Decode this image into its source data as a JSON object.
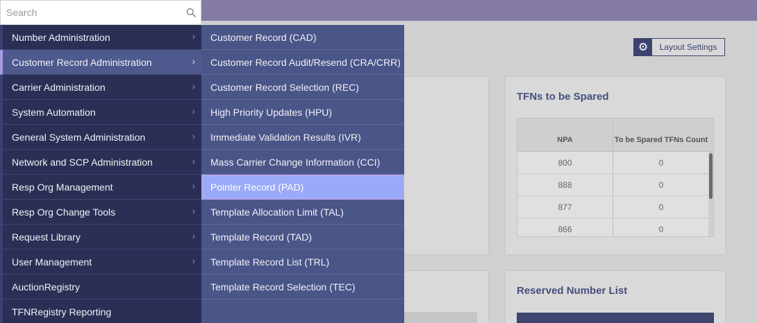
{
  "search": {
    "placeholder": "Search"
  },
  "layout_settings": {
    "label": "Layout Settings"
  },
  "menu": {
    "items": [
      {
        "label": "Number Administration",
        "has_submenu": true
      },
      {
        "label": "Customer Record Administration",
        "has_submenu": true,
        "active": true
      },
      {
        "label": "Carrier Administration",
        "has_submenu": true
      },
      {
        "label": "System Automation",
        "has_submenu": true
      },
      {
        "label": "General System Administration",
        "has_submenu": true
      },
      {
        "label": "Network and SCP Administration",
        "has_submenu": true
      },
      {
        "label": "Resp Org Management",
        "has_submenu": true
      },
      {
        "label": "Resp Org Change Tools",
        "has_submenu": true
      },
      {
        "label": "Request Library",
        "has_submenu": true
      },
      {
        "label": "User Management",
        "has_submenu": true
      },
      {
        "label": "AuctionRegistry",
        "has_submenu": false
      },
      {
        "label": "TFNRegistry Reporting",
        "has_submenu": false
      }
    ],
    "chevron": "›"
  },
  "submenu": {
    "items": [
      {
        "label": "Customer Record (CAD)"
      },
      {
        "label": "Customer Record Audit/Resend (CRA/CRR)"
      },
      {
        "label": "Customer Record Selection (REC)"
      },
      {
        "label": "High Priority Updates (HPU)"
      },
      {
        "label": "Immediate Validation Results (IVR)"
      },
      {
        "label": "Mass Carrier Change Information (CCI)"
      },
      {
        "label": "Pointer Record (PAD)",
        "hovered": true
      },
      {
        "label": "Template Allocation Limit (TAL)"
      },
      {
        "label": "Template Record (TAD)"
      },
      {
        "label": "Template Record List (TRL)"
      },
      {
        "label": "Template Record Selection (TEC)"
      }
    ]
  },
  "tfn_card": {
    "title": "TFNs to be Spared",
    "columns": [
      "NPA",
      "To be Spared TFNs Count"
    ],
    "rows": [
      [
        "800",
        "0"
      ],
      [
        "888",
        "0"
      ],
      [
        "877",
        "0"
      ],
      [
        "866",
        "0"
      ]
    ]
  },
  "reserved_card": {
    "title": "Reserved Number List"
  },
  "colors": {
    "topbar": "#857ba3",
    "menu_bg": "#2b2f55",
    "submenu_bg": "#4a5588",
    "active_item": "#4e5a8e",
    "hover_item": "#9aaaf8"
  },
  "icons": {
    "search": "search-icon",
    "settings": "gear-icon",
    "chevron": "chevron-right-icon"
  }
}
